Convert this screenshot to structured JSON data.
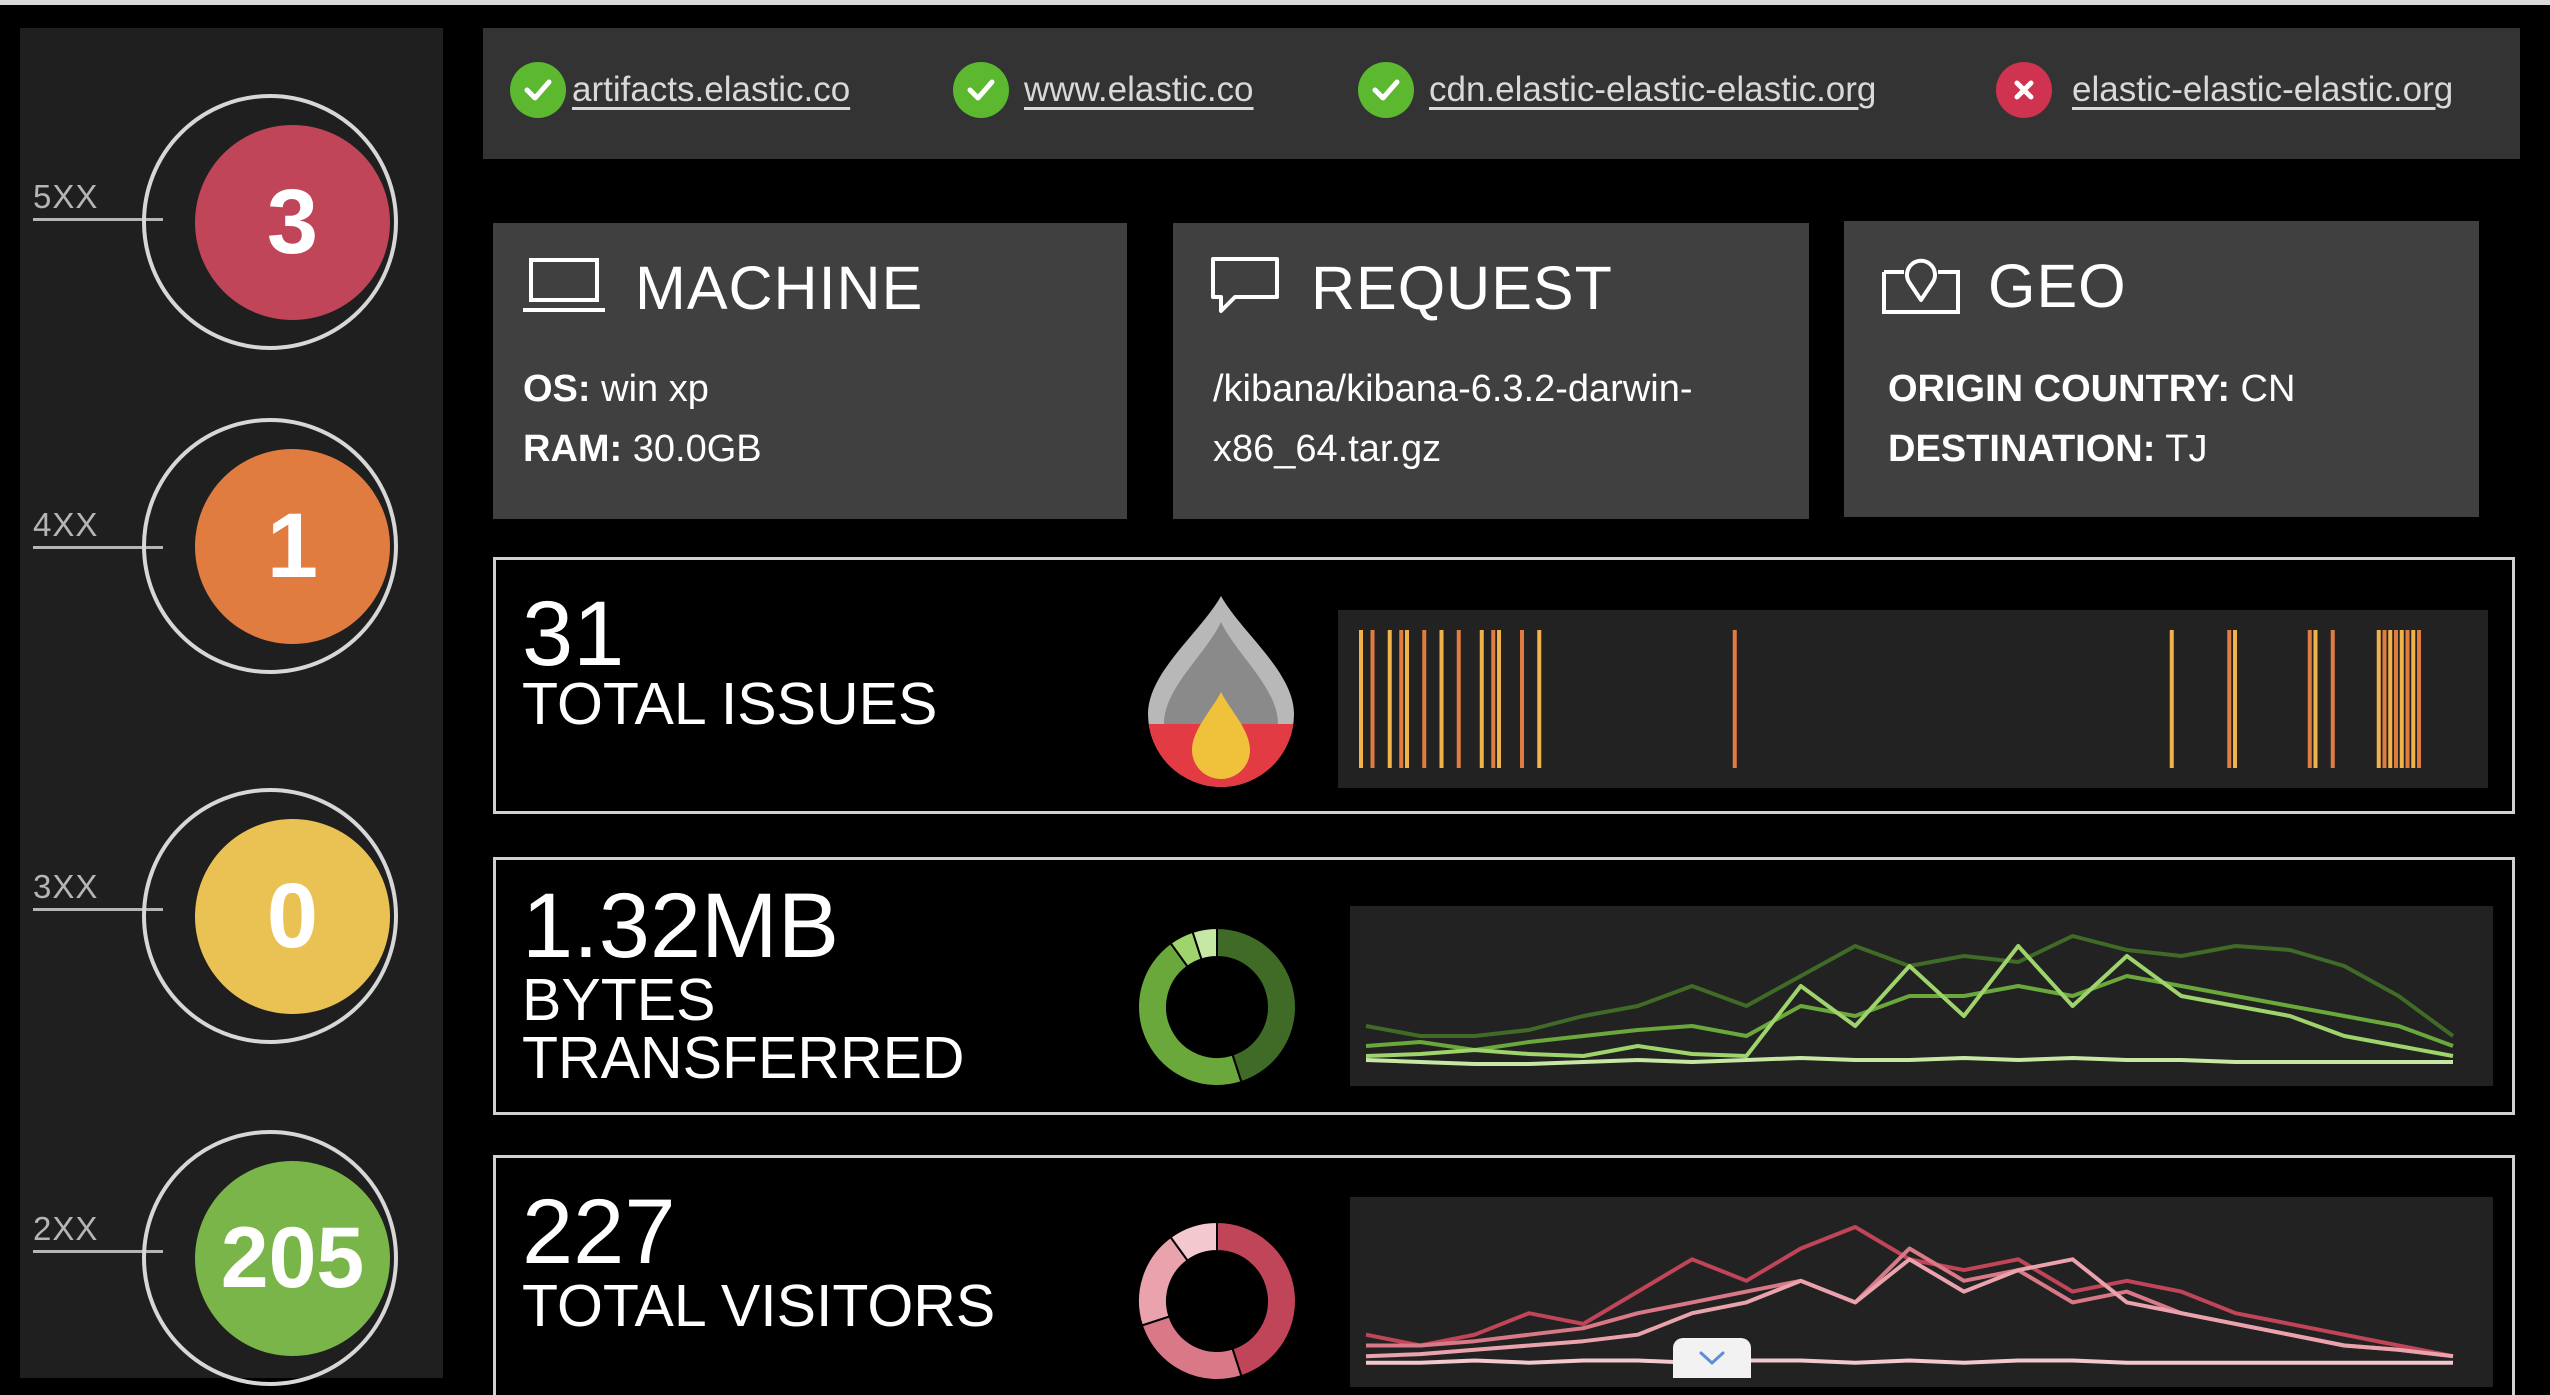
{
  "status": [
    {
      "label": "5XX",
      "value": "3",
      "color": "#c04558"
    },
    {
      "label": "4XX",
      "value": "1",
      "color": "#e07c40"
    },
    {
      "label": "3XX",
      "value": "0",
      "color": "#eac253"
    },
    {
      "label": "2XX",
      "value": "205",
      "color": "#79b548"
    }
  ],
  "urls": [
    {
      "text": "artifacts.elastic.co",
      "status": "ok"
    },
    {
      "text": "www.elastic.co",
      "status": "ok"
    },
    {
      "text": "cdn.elastic-elastic-elastic.org",
      "status": "ok"
    },
    {
      "text": "elastic-elastic-elastic.org",
      "status": "error"
    }
  ],
  "colors": {
    "ok": "#5cb82e",
    "error": "#d0334f"
  },
  "machine": {
    "title": "MACHINE",
    "os_label": "OS:",
    "os": " win xp",
    "ram_label": "RAM:",
    "ram": " 30.0GB",
    "icon": "laptop-icon"
  },
  "request": {
    "title": "REQUEST",
    "line1": "/kibana/kibana-6.3.2-darwin-",
    "line2": "x86_64.tar.gz",
    "icon": "speech-bubble-icon"
  },
  "geo": {
    "title": "GEO",
    "origin_label": "ORIGIN COUNTRY:",
    "origin": " CN",
    "dest_label": "DESTINATION:",
    "dest": " TJ",
    "icon": "map-pin-icon"
  },
  "issues": {
    "value": "31",
    "label": "TOTAL ISSUES",
    "icon": "flame-icon"
  },
  "bytes": {
    "value": "1.32MB",
    "label1": "BYTES",
    "label2": "TRANSFERRED"
  },
  "visitors": {
    "value": "227",
    "label": "TOTAL VISITORS"
  },
  "issue_ticks": {
    "colors": [
      "#f2b24a",
      "#e07c40"
    ],
    "x": [
      0.02,
      0.03,
      0.045,
      0.055,
      0.06,
      0.075,
      0.09,
      0.105,
      0.125,
      0.135,
      0.14,
      0.16,
      0.175,
      0.345,
      0.725,
      0.775,
      0.78,
      0.845,
      0.85,
      0.865,
      0.905,
      0.91,
      0.915,
      0.92,
      0.925,
      0.93,
      0.935,
      0.94
    ]
  },
  "chart_data": [
    {
      "type": "pie",
      "title": "",
      "values": [
        45,
        45,
        5,
        5
      ],
      "colors": [
        "#3f6b27",
        "#6aa83c",
        "#9fd36b",
        "#c7e8a4"
      ]
    },
    {
      "type": "line",
      "title": "",
      "x": [
        0,
        1,
        2,
        3,
        4,
        5,
        6,
        7,
        8,
        9,
        10,
        11,
        12,
        13,
        14,
        15,
        16,
        17,
        18,
        19,
        20
      ],
      "series": [
        {
          "color": "#3f6b27",
          "values": [
            2,
            1.5,
            1.5,
            1.8,
            2.5,
            3,
            4,
            3,
            4.5,
            6,
            5,
            5.5,
            5.2,
            6.5,
            5.8,
            5.5,
            6,
            5.8,
            5,
            3.5,
            1.5
          ]
        },
        {
          "color": "#6aa83c",
          "values": [
            1,
            1.2,
            0.8,
            1.2,
            1.5,
            1.8,
            2,
            1.5,
            3,
            2.5,
            3.5,
            3.5,
            4,
            3.5,
            4.5,
            4,
            3.5,
            3,
            2.5,
            2,
            1
          ]
        },
        {
          "color": "#9fd36b",
          "values": [
            0.5,
            0.6,
            0.8,
            0.6,
            0.5,
            1,
            0.6,
            0.5,
            4,
            2,
            5,
            2.5,
            6,
            3,
            5.5,
            3.5,
            3,
            2.5,
            1.5,
            1,
            0.5
          ]
        },
        {
          "color": "#c7e8a4",
          "values": [
            0.3,
            0.2,
            0.1,
            0.1,
            0.2,
            0.3,
            0.2,
            0.3,
            0.4,
            0.3,
            0.3,
            0.4,
            0.3,
            0.4,
            0.3,
            0.3,
            0.2,
            0.2,
            0.2,
            0.2,
            0.2
          ]
        }
      ]
    },
    {
      "type": "pie",
      "title": "",
      "values": [
        45,
        25,
        20,
        10
      ],
      "colors": [
        "#c04558",
        "#d97887",
        "#eaa3ad",
        "#f3c8ce"
      ]
    },
    {
      "type": "line",
      "title": "",
      "x": [
        0,
        1,
        2,
        3,
        4,
        5,
        6,
        7,
        8,
        9,
        10,
        11,
        12,
        13,
        14,
        15,
        16,
        17,
        18,
        19,
        20
      ],
      "series": [
        {
          "color": "#c04558",
          "values": [
            1.5,
            1,
            1.5,
            2.5,
            2,
            3.5,
            5,
            4,
            5.5,
            6.5,
            5,
            4.5,
            5,
            3.5,
            4,
            3.5,
            2.5,
            2,
            1.5,
            1,
            0.5
          ]
        },
        {
          "color": "#d97887",
          "values": [
            1,
            1,
            1.2,
            1.5,
            1.8,
            2.5,
            3,
            3.5,
            4,
            3,
            5.5,
            4,
            4.5,
            3,
            3.5,
            2.5,
            2,
            1.5,
            1,
            0.8,
            0.5
          ]
        },
        {
          "color": "#eaa3ad",
          "values": [
            0.5,
            0.6,
            0.8,
            1,
            1.2,
            1.5,
            2.5,
            3,
            4,
            3,
            5,
            3.5,
            4.5,
            5,
            3,
            2.5,
            2,
            1.5,
            1,
            0.8,
            0.5
          ]
        },
        {
          "color": "#f3c8ce",
          "values": [
            0.2,
            0.2,
            0.3,
            0.2,
            0.3,
            0.3,
            0.2,
            0.3,
            0.3,
            0.2,
            0.3,
            0.2,
            0.3,
            0.3,
            0.2,
            0.2,
            0.2,
            0.2,
            0.2,
            0.2,
            0.2
          ]
        }
      ]
    }
  ]
}
